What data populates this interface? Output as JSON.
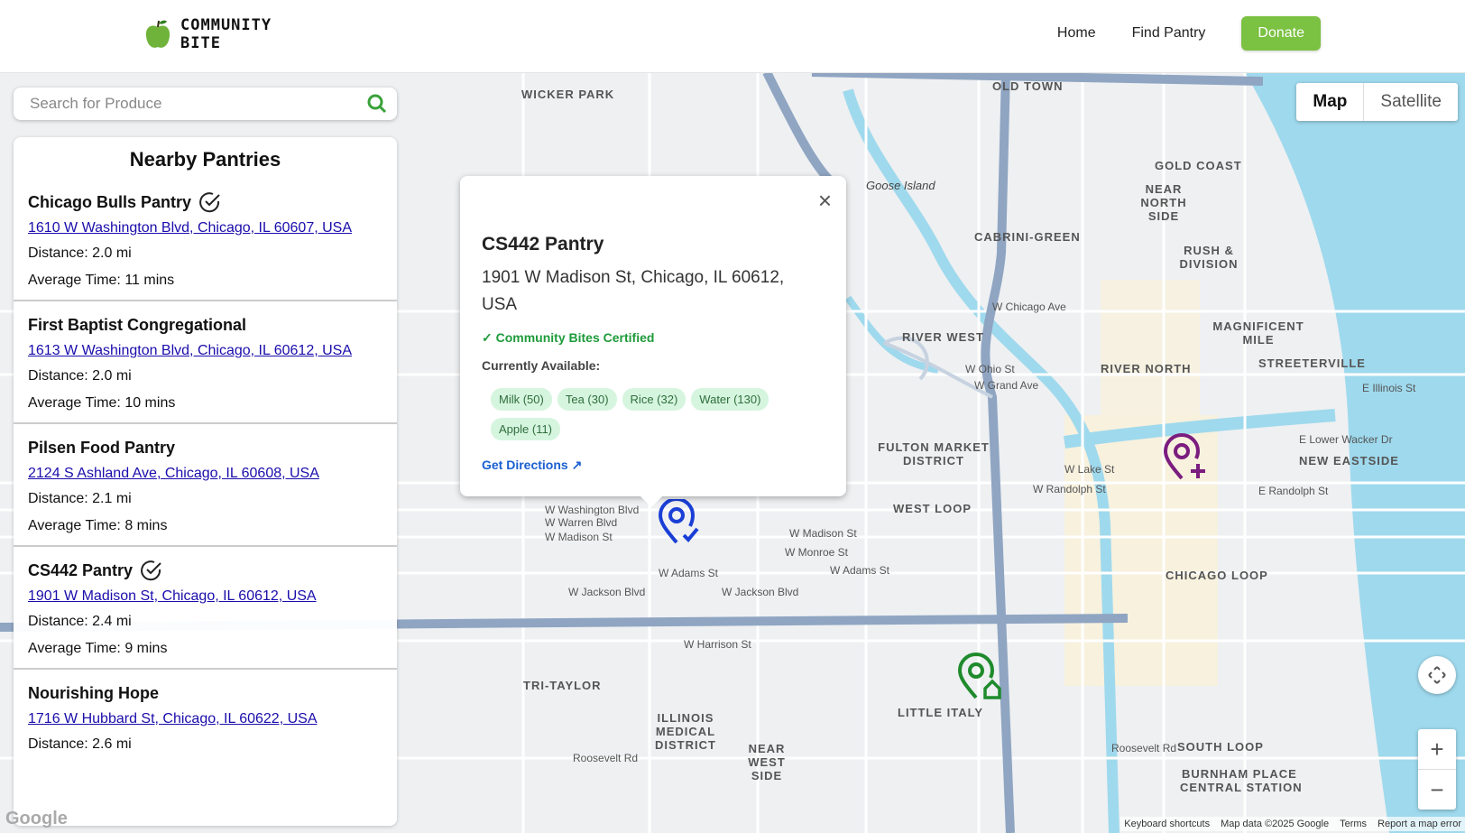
{
  "header": {
    "logo_text": "COMMUNITY\nBITE",
    "nav": {
      "home": "Home",
      "find_pantry": "Find Pantry",
      "donate": "Donate"
    },
    "donate_color": "#7bc142"
  },
  "search": {
    "placeholder": "Search for Produce"
  },
  "panel": {
    "title": "Nearby Pantries",
    "pantries": [
      {
        "name": "Chicago Bulls Pantry",
        "certified": true,
        "address": "1610 W Washington Blvd, Chicago, IL 60607, USA",
        "distance": "Distance: 2.0 mi",
        "time": "Average Time: 11 mins"
      },
      {
        "name": "First Baptist Congregational",
        "certified": false,
        "address": "1613 W Washington Blvd, Chicago, IL 60612, USA",
        "distance": "Distance: 2.0 mi",
        "time": "Average Time: 10 mins"
      },
      {
        "name": "Pilsen Food Pantry",
        "certified": false,
        "address": "2124 S Ashland Ave, Chicago, IL 60608, USA",
        "distance": "Distance: 2.1 mi",
        "time": "Average Time: 8 mins"
      },
      {
        "name": "CS442 Pantry",
        "certified": true,
        "address": "1901 W Madison St, Chicago, IL 60612, USA",
        "distance": "Distance: 2.4 mi",
        "time": "Average Time: 9 mins"
      },
      {
        "name": "Nourishing Hope",
        "certified": false,
        "address": "1716 W Hubbard St, Chicago, IL 60622, USA",
        "distance": "Distance: 2.6 mi",
        "time": ""
      }
    ]
  },
  "popup": {
    "title": "CS442 Pantry",
    "address": "1901 W Madison St, Chicago, IL 60612, USA",
    "certified": "✓ Community Bites Certified",
    "available_label": "Currently Available:",
    "items": [
      "Milk (50)",
      "Tea (30)",
      "Rice (32)",
      "Water (130)",
      "Apple (11)"
    ],
    "directions": "Get Directions ↗",
    "close": "×"
  },
  "map": {
    "toggle": {
      "map": "Map",
      "satellite": "Satellite"
    },
    "zoom_in": "+",
    "zoom_out": "−",
    "footer": {
      "shortcuts": "Keyboard shortcuts",
      "map_data": "Map data ©2025 Google",
      "terms": "Terms",
      "report": "Report a map error"
    },
    "google": "Google",
    "labels": {
      "wicker_park": "WICKER PARK",
      "old_town": "OLD TOWN",
      "gold_coast": "GOLD COAST",
      "near_north": "NEAR NORTH SIDE",
      "cabrini": "CABRINI-GREEN",
      "rush": "RUSH & DIVISION",
      "magnificent": "MAGNIFICENT MILE",
      "river_west": "RIVER WEST",
      "river_north": "RIVER NORTH",
      "streeterville": "STREETERVILLE",
      "fulton": "FULTON MARKET DISTRICT",
      "new_eastside": "NEW EASTSIDE",
      "west_loop": "WEST LOOP",
      "chicago_loop": "CHICAGO LOOP",
      "tri_taylor": "TRI-TAYLOR",
      "illinois_medical": "ILLINOIS MEDICAL DISTRICT",
      "little_italy": "LITTLE ITALY",
      "near_west": "NEAR WEST SIDE",
      "south_loop": "SOUTH LOOP",
      "burnham": "BURNHAM PLACE",
      "central_station": "CENTRAL STATION",
      "goose_island": "Goose Island",
      "w_chicago_ave": "W Chicago Ave",
      "w_ohio": "W Ohio St",
      "w_grand": "W Grand Ave",
      "w_lake": "W Lake St",
      "w_randolph": "W Randolph St",
      "w_washington": "W Washington Blvd",
      "w_warren": "W Warren Blvd",
      "w_madison": "W Madison St",
      "w_monroe": "W Monroe St",
      "w_adams": "W Adams St",
      "w_jackson": "W Jackson Blvd",
      "w_harrison": "W Harrison St",
      "roosevelt": "Roosevelt Rd",
      "e_lower_wacker": "E Lower Wacker Dr",
      "e_randolph": "E Randolph St",
      "e_illinois": "E Illinois St"
    }
  }
}
